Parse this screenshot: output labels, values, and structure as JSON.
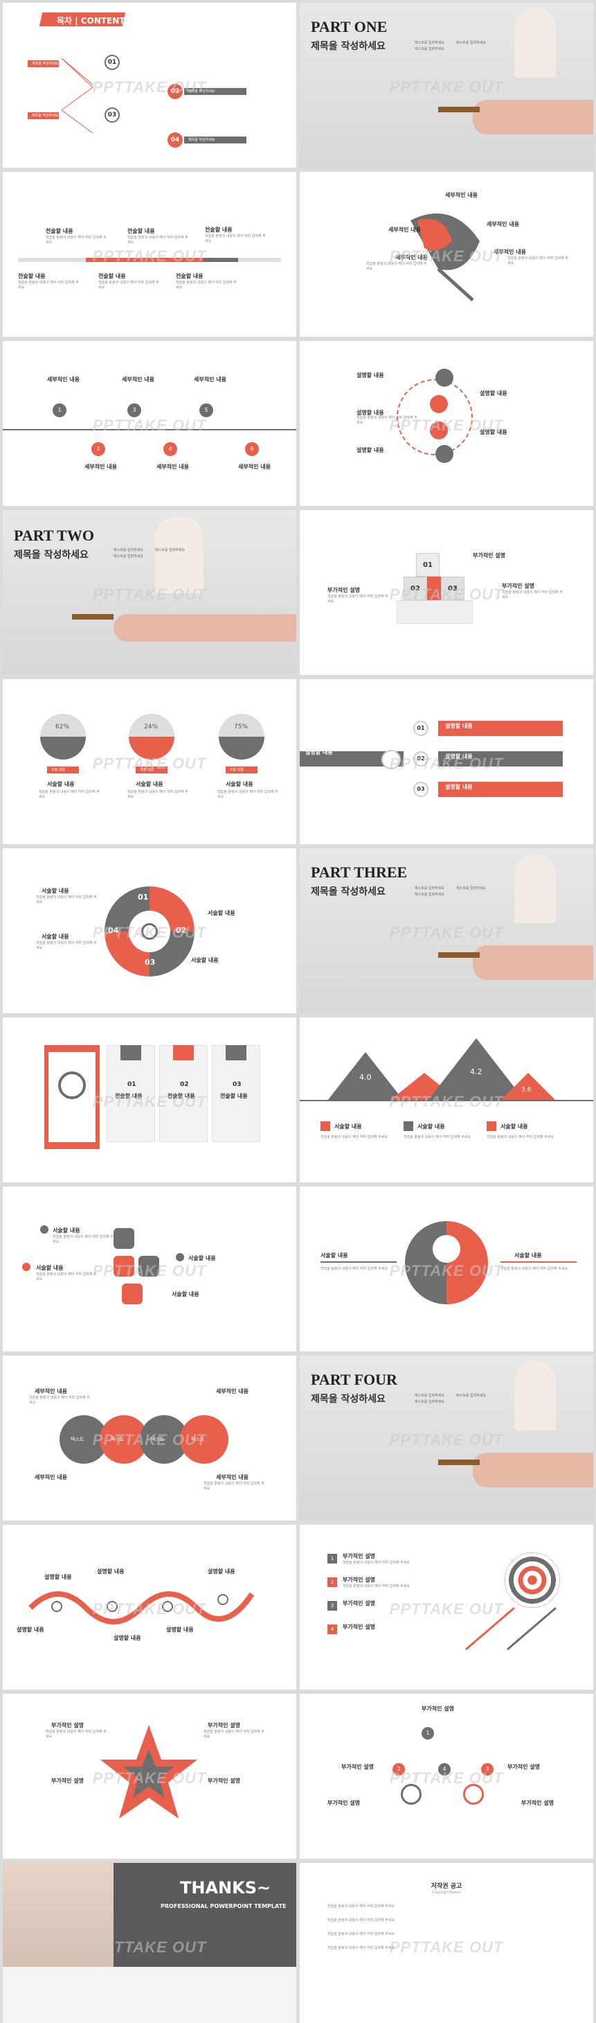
{
  "watermark": "PPTTAKE OUT",
  "colors": {
    "accent": "#e8604c",
    "dark": "#6e6e6e",
    "light": "#d9d9d9"
  },
  "toc": {
    "title": "목차 | CONTENTS",
    "items": [
      {
        "num": "01",
        "label": "제목을 작성하세요"
      },
      {
        "num": "02",
        "label": "제목을 작성하세요"
      },
      {
        "num": "03",
        "label": "제목을 작성하세요"
      },
      {
        "num": "04",
        "label": "제목을 작성하세요"
      }
    ]
  },
  "parts": [
    {
      "title": "PART ONE",
      "subtitle": "제목을 작성하세요",
      "bullets": [
        "텍스트를 입력하세요",
        "텍스트를 입력하세요",
        "텍스트를 입력하세요"
      ]
    },
    {
      "title": "PART TWO",
      "subtitle": "제목을 작성하세요",
      "bullets": [
        "텍스트를 입력하세요",
        "텍스트를 입력하세요",
        "텍스트를 입력하세요"
      ]
    },
    {
      "title": "PART THREE",
      "subtitle": "제목을 작성하세요",
      "bullets": [
        "텍스트를 입력하세요",
        "텍스트를 입력하세요",
        "텍스트를 입력하세요"
      ]
    },
    {
      "title": "PART FOUR",
      "subtitle": "제목을 작성하세요",
      "bullets": [
        "텍스트를 입력하세요",
        "텍스트를 입력하세요",
        "텍스트를 입력하세요"
      ]
    }
  ],
  "s3": {
    "labels": [
      "전술할 내용",
      "전술할 내용",
      "전술할 내용",
      "전술할 내용",
      "전술할 내용",
      "전술할 내용"
    ]
  },
  "s4": {
    "labels": [
      "세부적인 내용",
      "세부적인 내용",
      "세부적인 내용",
      "세부적인 내용",
      "세부적인 내용"
    ]
  },
  "s5": {
    "labels": [
      "세부적인 내용",
      "세부적인 내용",
      "세부적인 내용",
      "세부적인 내용",
      "세부적인 내용",
      "세부적인 내용"
    ],
    "nums": [
      "1",
      "2",
      "3",
      "4",
      "5",
      "6"
    ]
  },
  "s6": {
    "labels": [
      "설명할 내용",
      "설명할 내용",
      "설명할 내용",
      "설명할 내용",
      "설명할 내용",
      "설명할 내용"
    ]
  },
  "s8": {
    "labels": [
      "부가적인 설명",
      "부가적인 설명",
      "부가적인 설명"
    ],
    "nums": [
      "01",
      "02",
      "03"
    ]
  },
  "s9": {
    "values": [
      "62%",
      "24%",
      "75%"
    ],
    "labels": [
      "서술할 내용",
      "서술할 내용",
      "서술할 내용"
    ],
    "pills": [
      "서술 내용",
      "서술 내용",
      "서술 내용"
    ]
  },
  "s10": {
    "left_label": "설명할 내용",
    "items": [
      {
        "num": "01",
        "label": "설명할 내용"
      },
      {
        "num": "02",
        "label": "설명할 내용"
      },
      {
        "num": "03",
        "label": "설명할 내용"
      }
    ]
  },
  "s11": {
    "labels": [
      "서술할 내용",
      "서술할 내용",
      "서술할 내용",
      "서술할 내용"
    ],
    "nums": [
      "01",
      "02",
      "03",
      "04"
    ]
  },
  "s13": {
    "nums": [
      "01",
      "02",
      "03"
    ],
    "labels": [
      "전술할 내용",
      "전술할 내용",
      "전술할 내용"
    ]
  },
  "s14": {
    "values": [
      "4.0",
      "4.2",
      "3.6"
    ],
    "labels": [
      "서술할 내용",
      "서술할 내용",
      "서술할 내용"
    ]
  },
  "s15": {
    "labels": [
      "서술할 내용",
      "서술할 내용",
      "서술할 내용",
      "서술할 내용"
    ]
  },
  "s16": {
    "labels": [
      "서술할 내용",
      "서술할 내용"
    ]
  },
  "s17": {
    "labels": [
      "세부적인 내용",
      "세부적인 내용",
      "세부적인 내용",
      "세부적인 내용"
    ],
    "circles": [
      "텍스트",
      "텍스트",
      "텍스트",
      "텍스트"
    ]
  },
  "s19": {
    "labels": [
      "설명할 내용",
      "설명할 내용",
      "설명할 내용",
      "설명할 내용",
      "설명할 내용",
      "설명할 내용"
    ]
  },
  "s20": {
    "labels": [
      "부가적인 설명",
      "부가적인 설명",
      "부가적인 설명",
      "부가적인 설명"
    ],
    "nums": [
      "1",
      "2",
      "3",
      "4"
    ]
  },
  "s21": {
    "labels": [
      "부가적인 설명",
      "부가적인 설명",
      "부가적인 설명",
      "부가적인 설명"
    ]
  },
  "s22": {
    "labels": [
      "부가적인 설명",
      "부가적인 설명",
      "부가적인 설명",
      "부가적인 설명",
      "부가적인 설명"
    ],
    "nums": [
      "1",
      "2",
      "3",
      "4"
    ]
  },
  "thanks": {
    "title": "THANKS~",
    "subtitle": "PROFESSIONAL POWERPOINT TEMPLATE"
  },
  "copyright": {
    "title": "저작권 공고",
    "subtitle": "Copyright Notice"
  },
  "body_text": "학습을 분량과 내용이 해야 하며 입력해 주세요"
}
